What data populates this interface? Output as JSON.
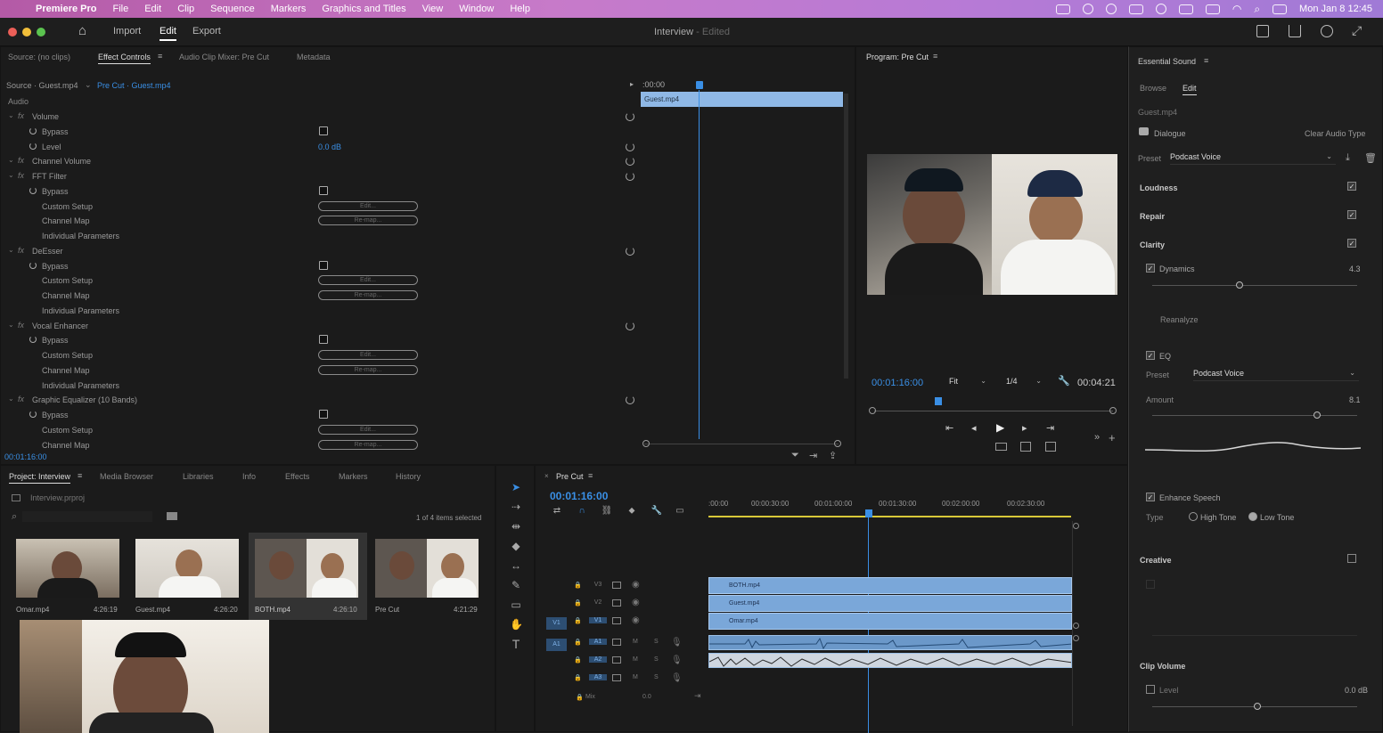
{
  "menubar": {
    "app": "Premiere Pro",
    "items": [
      "File",
      "Edit",
      "Clip",
      "Sequence",
      "Markers",
      "Graphics and Titles",
      "View",
      "Window",
      "Help"
    ],
    "datetime": "Mon Jan 8  12:45"
  },
  "header": {
    "tabs": [
      "Import",
      "Edit",
      "Export"
    ],
    "active_tab": "Edit",
    "title": "Interview",
    "title_suffix": "- Edited"
  },
  "source_panel": {
    "tabs": [
      "Source: (no clips)",
      "Effect Controls",
      "Audio Clip Mixer: Pre Cut",
      "Metadata"
    ],
    "active_tab": "Effect Controls",
    "source_path": "Source · Guest.mp4",
    "clip_path": "Pre Cut · Guest.mp4",
    "section": "Audio",
    "timecode_top": ":00:00",
    "clip_name": "Guest.mp4",
    "timecode_bottom": "00:01:16:00",
    "rows": [
      {
        "label": "Volume",
        "type": "fx",
        "indent": 0
      },
      {
        "label": "Bypass",
        "type": "prop",
        "indent": 1,
        "control": "checkbox"
      },
      {
        "label": "Level",
        "type": "prop",
        "indent": 1,
        "value": "0.0 dB"
      },
      {
        "label": "Channel Volume",
        "type": "fx",
        "indent": 0
      },
      {
        "label": "FFT Filter",
        "type": "fx",
        "indent": 0
      },
      {
        "label": "Bypass",
        "type": "prop",
        "indent": 1,
        "control": "checkbox"
      },
      {
        "label": "Custom Setup",
        "type": "prop",
        "indent": 1,
        "control": "pill",
        "pill": "Edit..."
      },
      {
        "label": "Channel Map",
        "type": "prop",
        "indent": 1,
        "control": "pill",
        "pill": "Re-map..."
      },
      {
        "label": "Individual Parameters",
        "type": "prop",
        "indent": 1
      },
      {
        "label": "DeEsser",
        "type": "fx",
        "indent": 0
      },
      {
        "label": "Bypass",
        "type": "prop",
        "indent": 1,
        "control": "checkbox"
      },
      {
        "label": "Custom Setup",
        "type": "prop",
        "indent": 1,
        "control": "pill",
        "pill": "Edit..."
      },
      {
        "label": "Channel Map",
        "type": "prop",
        "indent": 1,
        "control": "pill",
        "pill": "Re-map..."
      },
      {
        "label": "Individual Parameters",
        "type": "prop",
        "indent": 1
      },
      {
        "label": "Vocal Enhancer",
        "type": "fx",
        "indent": 0
      },
      {
        "label": "Bypass",
        "type": "prop",
        "indent": 1,
        "control": "checkbox"
      },
      {
        "label": "Custom Setup",
        "type": "prop",
        "indent": 1,
        "control": "pill",
        "pill": "Edit..."
      },
      {
        "label": "Channel Map",
        "type": "prop",
        "indent": 1,
        "control": "pill",
        "pill": "Re-map..."
      },
      {
        "label": "Individual Parameters",
        "type": "prop",
        "indent": 1
      },
      {
        "label": "Graphic Equalizer (10 Bands)",
        "type": "fx",
        "indent": 0
      },
      {
        "label": "Bypass",
        "type": "prop",
        "indent": 1,
        "control": "checkbox"
      },
      {
        "label": "Custom Setup",
        "type": "prop",
        "indent": 1,
        "control": "pill",
        "pill": "Edit..."
      },
      {
        "label": "Channel Map",
        "type": "prop",
        "indent": 1,
        "control": "pill",
        "pill": "Re-map..."
      }
    ]
  },
  "program": {
    "title": "Program: Pre Cut",
    "timecode": "00:01:16:00",
    "fit": "Fit",
    "resolution": "1/4",
    "duration": "00:04:21"
  },
  "project": {
    "tabs": [
      "Project: Interview",
      "Media Browser",
      "Libraries",
      "Info",
      "Effects",
      "Markers",
      "History"
    ],
    "active_tab": "Project: Interview",
    "file": "Interview.prproj",
    "selection": "1 of 4 items selected",
    "items": [
      {
        "name": "Omar.mp4",
        "duration": "4:26:19"
      },
      {
        "name": "Guest.mp4",
        "duration": "4:26:20"
      },
      {
        "name": "BOTH.mp4",
        "duration": "4:26:10"
      },
      {
        "name": "Pre Cut",
        "duration": "4:21:29"
      }
    ]
  },
  "timeline": {
    "title": "Pre Cut",
    "timecode": "00:01:16:00",
    "ruler": [
      ":00:00",
      "00:00:30:00",
      "00:01:00:00",
      "00:01:30:00",
      "00:02:00:00",
      "00:02:30:00"
    ],
    "video_tracks": [
      "V3",
      "V2",
      "V1"
    ],
    "audio_tracks": [
      "A1",
      "A2",
      "A3"
    ],
    "clips": [
      "BOTH.mp4",
      "Guest.mp4",
      "Omar.mp4"
    ],
    "mix_label": "Mix",
    "mix_value": "0.0",
    "v1_src": "V1",
    "a1_src": "A1"
  },
  "essential_sound": {
    "title": "Essential Sound",
    "tabs": [
      "Browse",
      "Edit"
    ],
    "active_tab": "Edit",
    "clip": "Guest.mp4",
    "audio_type": "Dialogue",
    "clear_label": "Clear Audio Type",
    "preset_label": "Preset",
    "preset": "Podcast Voice",
    "sections": [
      "Loudness",
      "Repair",
      "Clarity"
    ],
    "dynamics_label": "Dynamics",
    "dynamics_value": "4.3",
    "reanalyze": "Reanalyze",
    "eq_label": "EQ",
    "eq_preset_label": "Preset",
    "eq_preset": "Podcast Voice",
    "amount_label": "Amount",
    "amount_value": "8.1",
    "enhance_speech": "Enhance Speech",
    "type_label": "Type",
    "high_tone": "High Tone",
    "low_tone": "Low Tone",
    "creative": "Creative",
    "clip_volume": "Clip Volume",
    "level_label": "Level",
    "level_value": "0.0 dB"
  }
}
